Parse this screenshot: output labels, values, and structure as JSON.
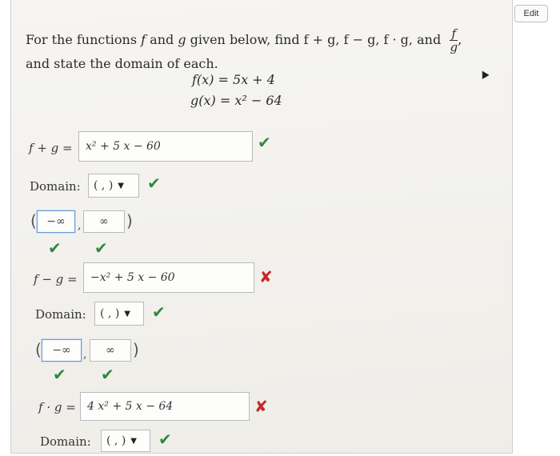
{
  "toolbar": {
    "edit_label": "Edit"
  },
  "prompt": {
    "line1_pre": "For the functions ",
    "f": "f",
    "and_word": " and ",
    "g": "g",
    "line1_post": " given below, find f + g, f − g, f · g,  and",
    "frac_num": "f",
    "frac_den": "g",
    "frac_trailing": ",",
    "line2": "and state the domain of each."
  },
  "functions": {
    "f_def": "f(x) = 5x + 4",
    "g_def": "g(x) = x² − 64"
  },
  "sum": {
    "lhs": "f + g =",
    "answer": "x² + 5 x − 60",
    "result": "correct",
    "domain_label": "Domain:",
    "domain_select": "( , )",
    "left_bound": "−∞",
    "right_bound": "∞",
    "open_paren": "(",
    "close_paren": ")",
    "separator": ","
  },
  "difference": {
    "lhs": "f − g =",
    "answer": "−x² + 5 x − 60",
    "result": "incorrect",
    "domain_label": "Domain:",
    "domain_select": "( , )",
    "left_bound": "−∞",
    "right_bound": "∞",
    "open_paren": "(",
    "close_paren": ")",
    "separator": ","
  },
  "product": {
    "lhs": "f · g =",
    "answer": "4 x² + 5 x − 64",
    "result": "incorrect",
    "domain_label": "Domain:",
    "domain_select": "( , )"
  },
  "marks": {
    "check": "✔",
    "cross": "✘"
  },
  "colors": {
    "check": "#2e8b3d",
    "cross": "#c62828",
    "focus_border": "#6b9bd6"
  }
}
